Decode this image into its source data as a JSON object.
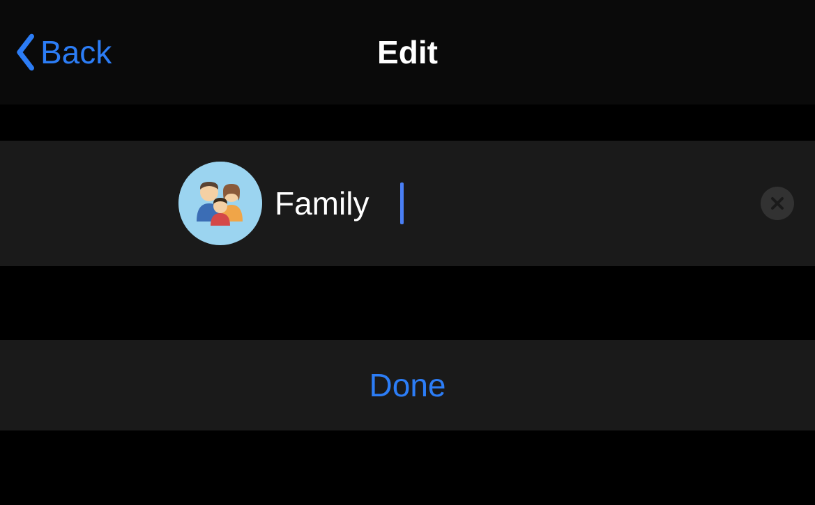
{
  "header": {
    "back_label": "Back",
    "title": "Edit"
  },
  "edit": {
    "name_value": "Family",
    "avatar_icon": "family-icon"
  },
  "actions": {
    "done_label": "Done"
  },
  "colors": {
    "accent": "#2c7df6",
    "row_bg": "#1a1a1a",
    "avatar_bg": "#9bd4f0"
  }
}
